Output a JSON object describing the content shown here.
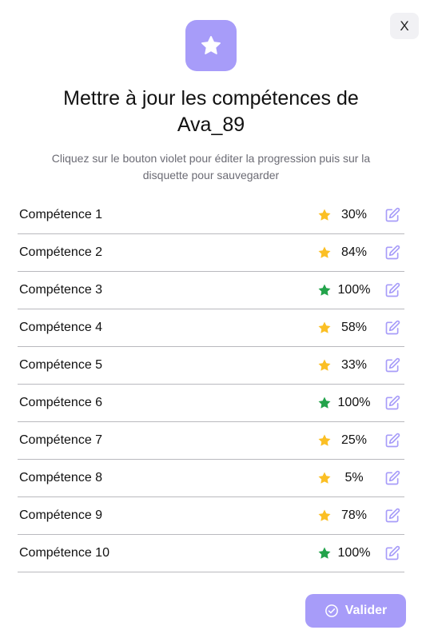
{
  "dialog": {
    "close_label": "X",
    "title_line1": "Mettre à jour les compétences de",
    "title_line2": "Ava_89",
    "subtitle_line1": "Cliquez sur le bouton violet pour éditer la progression puis sur la",
    "subtitle_line2": "disquette pour sauvegarder",
    "hero_icon": "star-icon",
    "submit_label": "Valider",
    "submit_icon": "check-circle-icon"
  },
  "colors": {
    "accent": "#a79cf9",
    "star_in_progress": "#fbbf24",
    "star_complete": "#22a34a",
    "divider": "#b9b9be",
    "subtitle_text": "#6b6b74"
  },
  "skills": [
    {
      "name": "Compétence 1",
      "progress": "30%",
      "complete": false
    },
    {
      "name": "Compétence 2",
      "progress": "84%",
      "complete": false
    },
    {
      "name": "Compétence 3",
      "progress": "100%",
      "complete": true
    },
    {
      "name": "Compétence 4",
      "progress": "58%",
      "complete": false
    },
    {
      "name": "Compétence 5",
      "progress": "33%",
      "complete": false
    },
    {
      "name": "Compétence 6",
      "progress": "100%",
      "complete": true
    },
    {
      "name": "Compétence 7",
      "progress": "25%",
      "complete": false
    },
    {
      "name": "Compétence 8",
      "progress": "5%",
      "complete": false
    },
    {
      "name": "Compétence 9",
      "progress": "78%",
      "complete": false
    },
    {
      "name": "Compétence 10",
      "progress": "100%",
      "complete": true
    }
  ]
}
